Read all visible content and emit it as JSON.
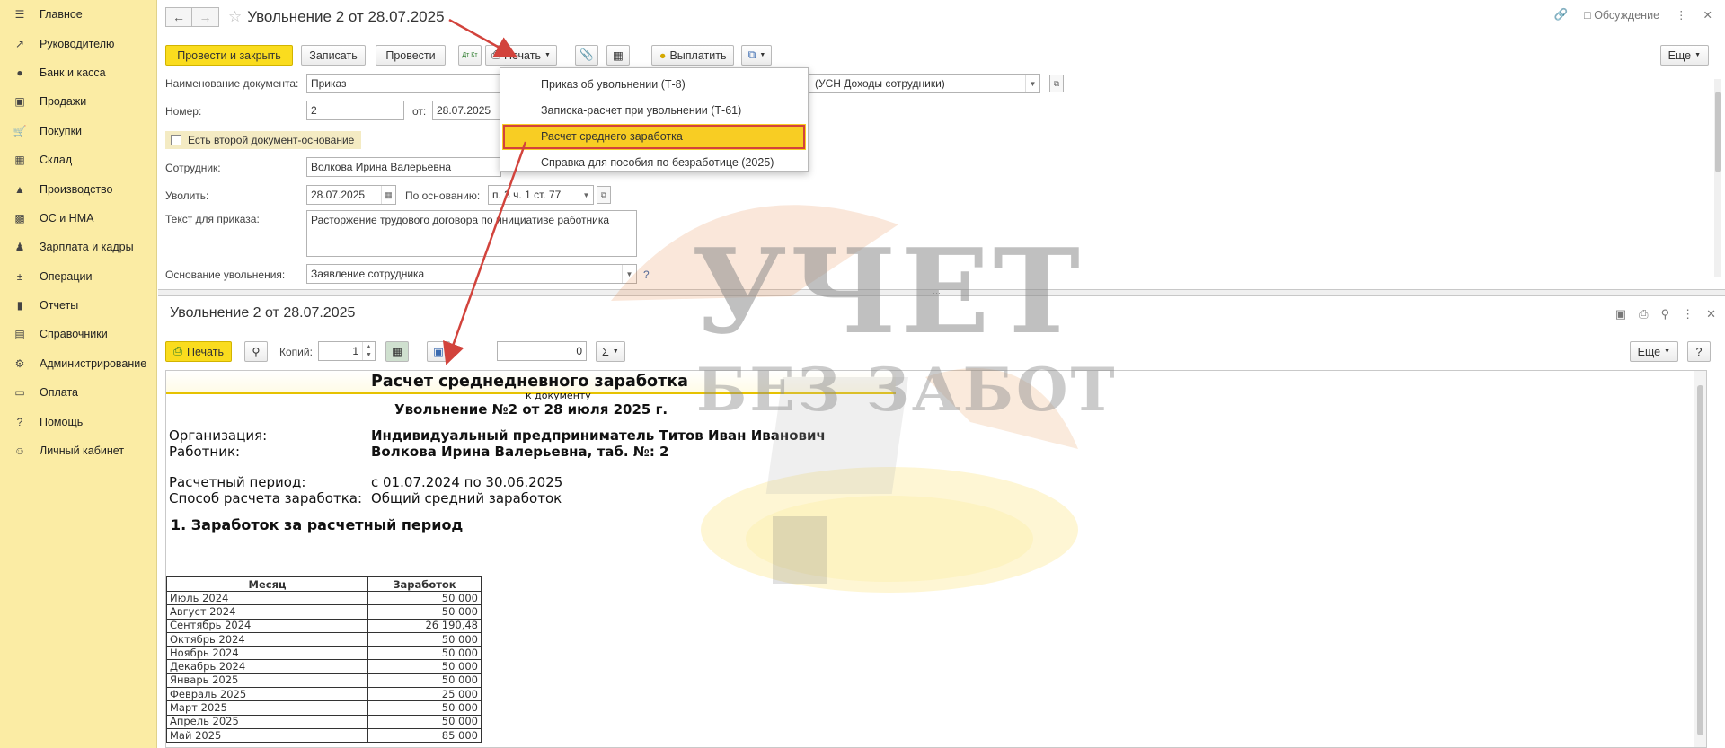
{
  "sidebar": {
    "items": [
      {
        "label": "Главное",
        "icon": "menu-icon"
      },
      {
        "label": "Руководителю",
        "icon": "trend-icon"
      },
      {
        "label": "Банк и касса",
        "icon": "coins-icon"
      },
      {
        "label": "Продажи",
        "icon": "bag-icon"
      },
      {
        "label": "Покупки",
        "icon": "cart-icon"
      },
      {
        "label": "Склад",
        "icon": "warehouse-icon"
      },
      {
        "label": "Производство",
        "icon": "factory-icon"
      },
      {
        "label": "ОС и НМА",
        "icon": "truck-icon"
      },
      {
        "label": "Зарплата и кадры",
        "icon": "people-icon"
      },
      {
        "label": "Операции",
        "icon": "operations-icon"
      },
      {
        "label": "Отчеты",
        "icon": "chart-icon"
      },
      {
        "label": "Справочники",
        "icon": "books-icon"
      },
      {
        "label": "Администрирование",
        "icon": "gear-icon"
      },
      {
        "label": "Оплата",
        "icon": "payment-icon"
      },
      {
        "label": "Помощь",
        "icon": "question-icon"
      },
      {
        "label": "Личный кабинет",
        "icon": "user-icon"
      }
    ]
  },
  "form": {
    "title": "Увольнение 2 от 28.07.2025",
    "discussion": "Обсуждение",
    "toolbar": {
      "post_close": "Провести и закрыть",
      "save": "Записать",
      "post": "Провести",
      "dt_kt": "Дт Кт",
      "print": "Печать",
      "pay": "Выплатить",
      "more": "Еще"
    },
    "doc_name_label": "Наименование документа:",
    "doc_name_value": "Приказ",
    "org_value": "(УСН Доходы сотрудники)",
    "number_label": "Номер:",
    "number_value": "2",
    "from_label": "от:",
    "date_value": "28.07.2025",
    "second_basis_label": "Есть второй документ-основание",
    "employee_label": "Сотрудник:",
    "employee_value": "Волкова Ирина Валерьевна",
    "dismiss_label": "Уволить:",
    "dismiss_date": "28.07.2025",
    "basis_label": "По основанию:",
    "basis_value": "п. 3 ч. 1 ст. 77",
    "order_text_label": "Текст для приказа:",
    "order_text_value": "Расторжение трудового договора по инициативе работника",
    "dismiss_reason_label": "Основание увольнения:",
    "dismiss_reason_value": "Заявление сотрудника",
    "help_mark": "?"
  },
  "print_menu": {
    "items": [
      "Приказ об увольнении (Т-8)",
      "Записка-расчет при увольнении (Т-61)",
      "Расчет среднего заработка",
      "Справка для пособия по безработице (2025)"
    ],
    "active_index": 2
  },
  "print_panel": {
    "title": "Увольнение 2 от 28.07.2025",
    "print_button": "Печать",
    "copies_label": "Копий:",
    "copies_value": "1",
    "sum_value": "0",
    "more": "Еще",
    "help": "?"
  },
  "document": {
    "heading": "Расчет среднедневного заработка",
    "subheading": "к документу",
    "doc_ref": "Увольнение №2 от 28 июля 2025 г.",
    "org_label": "Организация:",
    "org_value": "Индивидуальный предприниматель Титов Иван Иванович",
    "worker_label": "Работник:",
    "worker_value": "Волкова Ирина Валерьевна, таб. №: 2",
    "period_label": "Расчетный период:",
    "period_value": "с 01.07.2024 по 30.06.2025",
    "method_label": "Способ расчета заработка:",
    "method_value": "Общий средний заработок",
    "section1": "1. Заработок за расчетный период",
    "table_headers": [
      "Месяц",
      "Заработок"
    ],
    "table_rows": [
      [
        "Июль 2024",
        "50 000"
      ],
      [
        "Август 2024",
        "50 000"
      ],
      [
        "Сентябрь 2024",
        "26 190,48"
      ],
      [
        "Октябрь 2024",
        "50 000"
      ],
      [
        "Ноябрь 2024",
        "50 000"
      ],
      [
        "Декабрь 2024",
        "50 000"
      ],
      [
        "Январь 2025",
        "50 000"
      ],
      [
        "Февраль 2025",
        "25 000"
      ],
      [
        "Март 2025",
        "50 000"
      ],
      [
        "Апрель 2025",
        "50 000"
      ],
      [
        "Май 2025",
        "85 000"
      ]
    ]
  },
  "watermark": {
    "line1": "УЧЕТ",
    "line2": "БЕЗ ЗАБОТ"
  },
  "colors": {
    "sidebar_bg": "#fbeca4",
    "primary_button": "#fadc1e",
    "menu_active": "#f8cd23",
    "annotation_red": "#d2433c"
  }
}
